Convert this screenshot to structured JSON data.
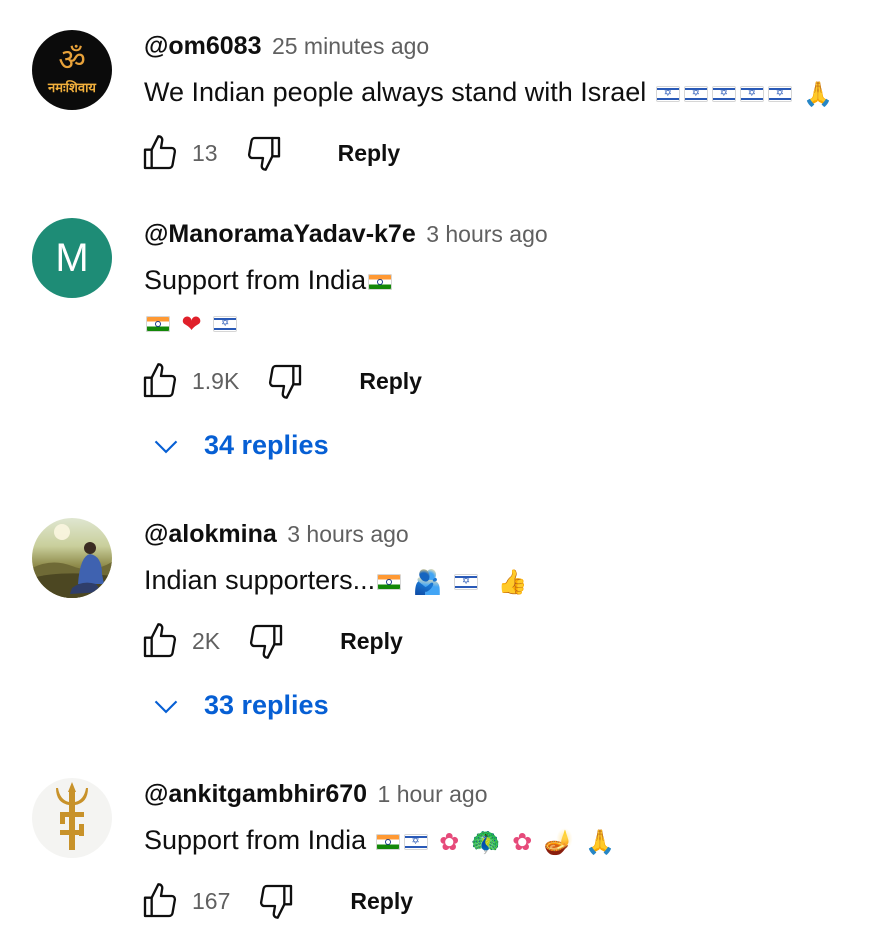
{
  "comments": [
    {
      "author": "@om6083",
      "time": "25 minutes ago",
      "text": "We Indian people always stand with Israel",
      "likes": "13",
      "reply_label": "Reply",
      "avatar": {
        "glyph": "ॐ",
        "text": "नमःशिवाय"
      }
    },
    {
      "author": "@ManoramaYadav-k7e",
      "time": "3 hours ago",
      "text": "Support from India",
      "likes": "1.9K",
      "reply_label": "Reply",
      "replies_label": "34 replies",
      "avatar": {
        "initial": "M",
        "color": "#1e8c76"
      }
    },
    {
      "author": "@alokmina",
      "time": "3 hours ago",
      "text": "Indian supporters...",
      "likes": "2K",
      "reply_label": "Reply",
      "replies_label": "33 replies"
    },
    {
      "author": "@ankitgambhir670",
      "time": "1 hour ago",
      "text": "Support from India ",
      "likes": "167",
      "reply_label": "Reply"
    }
  ],
  "colors": {
    "link": "#065fd4",
    "secondary_text": "#606060",
    "text": "#0f0f0f"
  },
  "icons": [
    "thumb-up-icon",
    "thumb-down-icon",
    "chevron-down-icon",
    "flag-israel-icon",
    "flag-india-icon",
    "folded-hands-emoji",
    "red-heart-emoji",
    "people-hugging-emoji",
    "thumbs-up-emoji",
    "hibiscus-emoji",
    "peacock-emoji",
    "diya-lamp-emoji"
  ]
}
